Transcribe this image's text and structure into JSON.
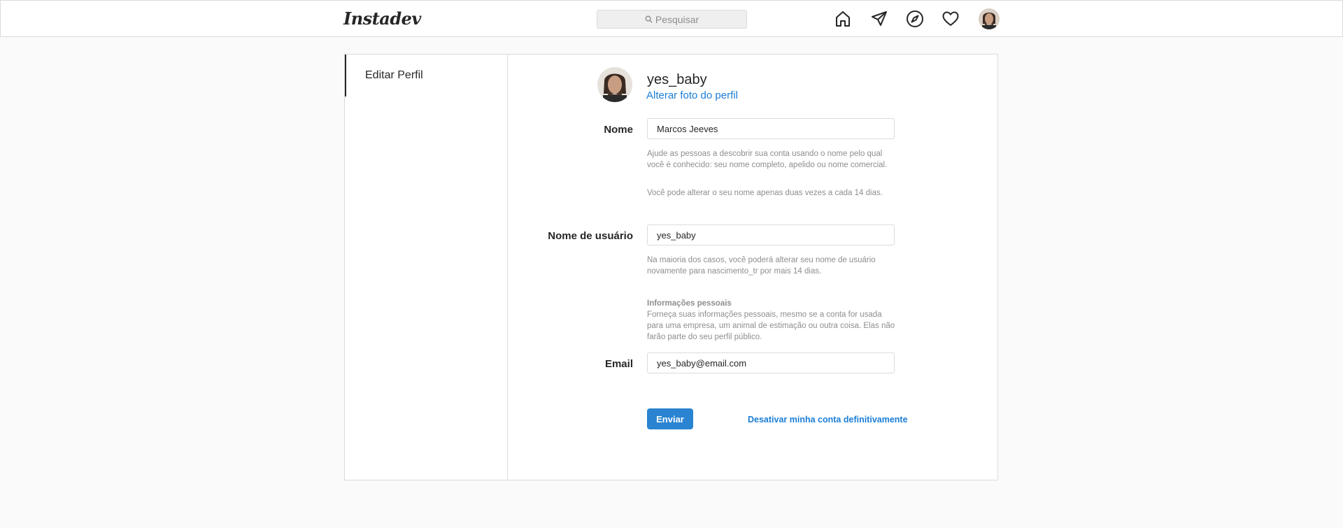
{
  "app": {
    "logo_text": "Instadev"
  },
  "search": {
    "placeholder": "Pesquisar",
    "icon": "search-icon"
  },
  "nav": {
    "icons": [
      "home-icon",
      "send-icon",
      "explore-icon",
      "heart-icon",
      "avatar"
    ]
  },
  "sidebar": {
    "items": [
      {
        "label": "Editar Perfil"
      }
    ]
  },
  "profile": {
    "username": "yes_baby",
    "change_photo_label": "Alterar foto do perfil"
  },
  "form": {
    "name": {
      "label": "Nome",
      "value": "Marcos Jeeves",
      "help_1": "Ajude as pessoas a descobrir sua conta usando o nome pelo qual você é conhecido: seu nome completo, apelido ou nome comercial.",
      "help_2": "Você pode alterar o seu nome apenas duas vezes a cada 14 dias."
    },
    "username": {
      "label": "Nome de usuário",
      "value": "yes_baby",
      "help": "Na maioria dos casos, você poderá alterar seu nome de usuário novamente para nascimento_tr por mais 14 dias."
    },
    "personal_info": {
      "title": "Informações pessoais",
      "text": "Forneça suas informações pessoais, mesmo se a conta for usada para uma empresa, um animal de estimação ou outra coisa. Elas não farão parte do seu perfil público."
    },
    "email": {
      "label": "Email",
      "value": "yes_baby@email.com"
    },
    "submit_label": "Enviar",
    "deactivate_label": "Desativar minha conta definitivamente"
  },
  "colors": {
    "accent": "#2b84d1",
    "link": "#1a7dd6",
    "border": "#dbdbdb",
    "background": "#fafafa"
  }
}
